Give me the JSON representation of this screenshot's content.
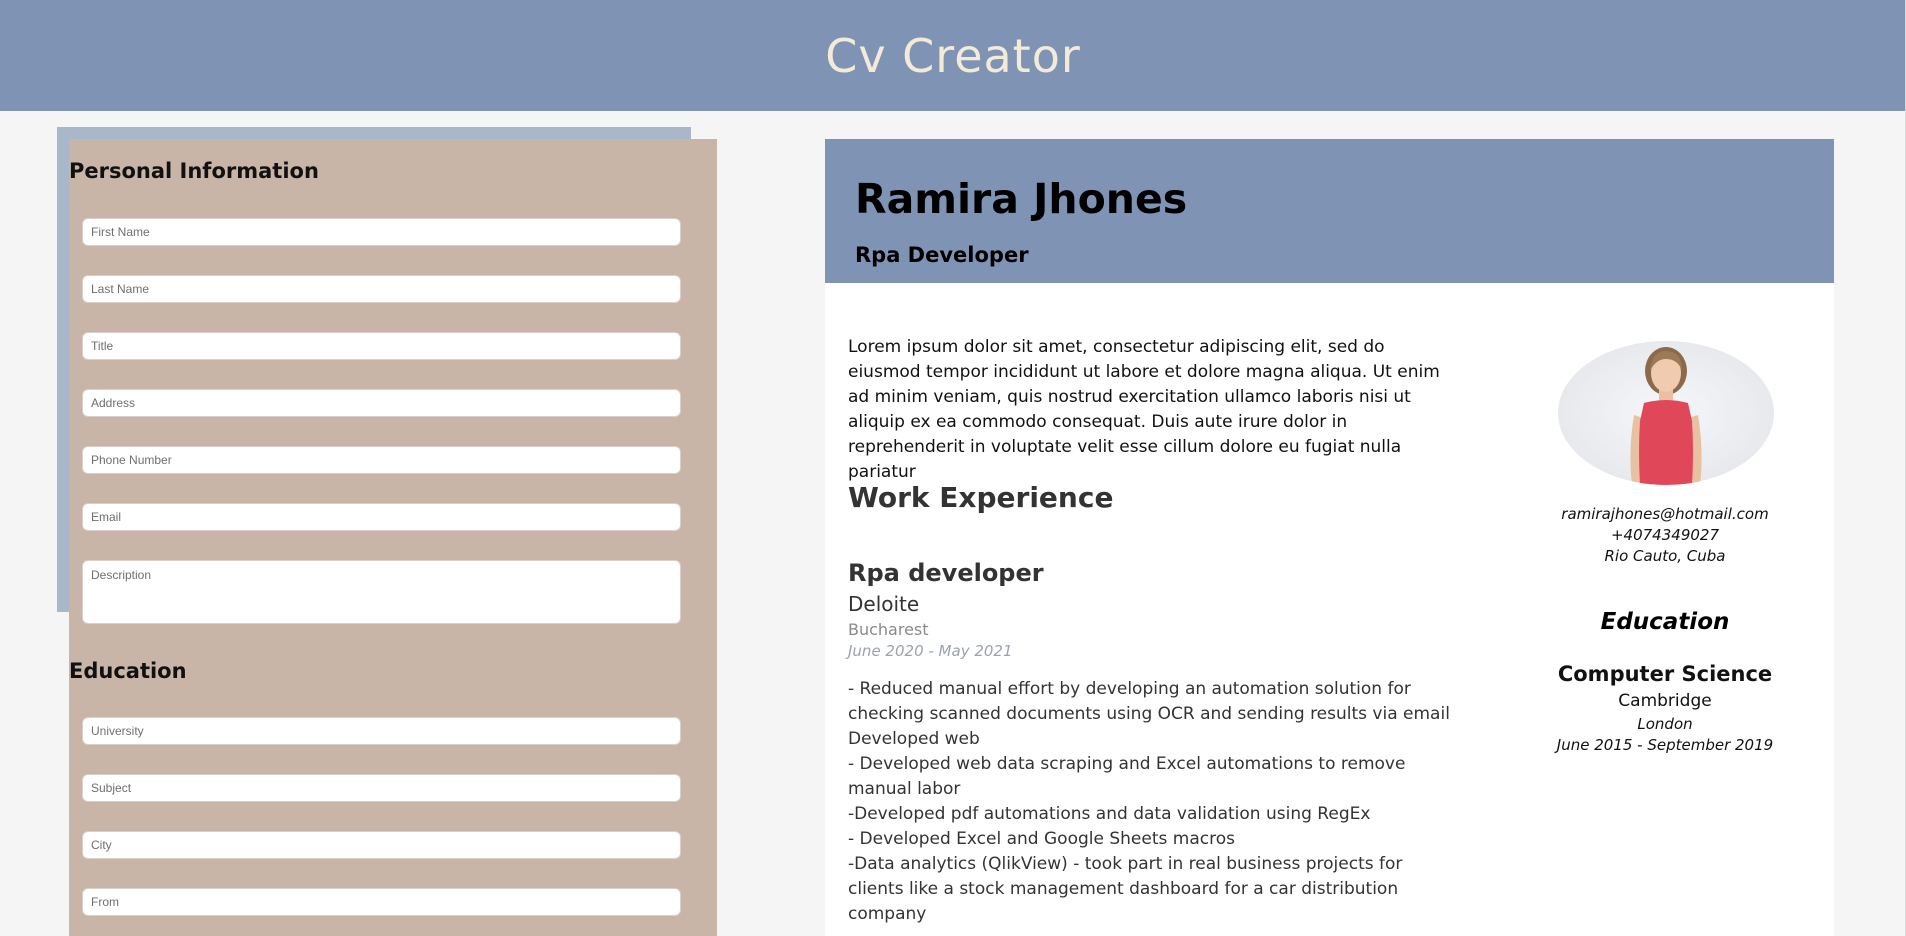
{
  "app": {
    "title": "Cv Creator"
  },
  "form": {
    "personal_title": "Personal Information",
    "personal_fields": {
      "first_name": "First Name",
      "last_name": "Last Name",
      "title": "Title",
      "address": "Address",
      "phone": "Phone Number",
      "email": "Email",
      "description": "Description"
    },
    "education_title": "Education",
    "education_fields": {
      "university": "University",
      "subject": "Subject",
      "city": "City",
      "from": "From"
    }
  },
  "cv": {
    "name": "Ramira Jhones",
    "title": "Rpa Developer",
    "description": "Lorem ipsum dolor sit amet, consectetur adipiscing elit, sed do eiusmod tempor incididunt ut labore et dolore magna aliqua. Ut enim ad minim veniam, quis nostrud exercitation ullamco laboris nisi ut aliquip ex ea commodo consequat. Duis aute irure dolor in reprehenderit in voluptate velit esse cillum dolore eu fugiat nulla pariatur",
    "work_heading": "Work Experience",
    "job": {
      "position": "Rpa developer",
      "company": "Deloite",
      "city": "Bucharest",
      "dates": "June 2020 - May 2021",
      "lines": [
        "- Reduced manual effort by developing an automation solution for checking scanned documents using OCR and sending results via email Developed web",
        "- Developed web data scraping and Excel automations to remove manual labor",
        "-Developed pdf automations and data validation using RegEx",
        "- Developed Excel and Google Sheets macros",
        "-Data analytics (QlikView) - took part in real business projects for clients like a stock management dashboard for a car distribution company"
      ]
    },
    "contact": {
      "email": "ramirajhones@hotmail.com",
      "phone": "+4074349027",
      "address": "Rio Cauto, Cuba"
    },
    "education": {
      "heading": "Education",
      "subject": "Computer Science",
      "university": "Cambridge",
      "city": "London",
      "dates": "June 2015 - September 2019"
    }
  },
  "colors": {
    "header": "#7f94b4",
    "title_text": "#f3ead8",
    "form_panel": "#c8b5a7",
    "form_shadow": "#a9b7cb"
  }
}
